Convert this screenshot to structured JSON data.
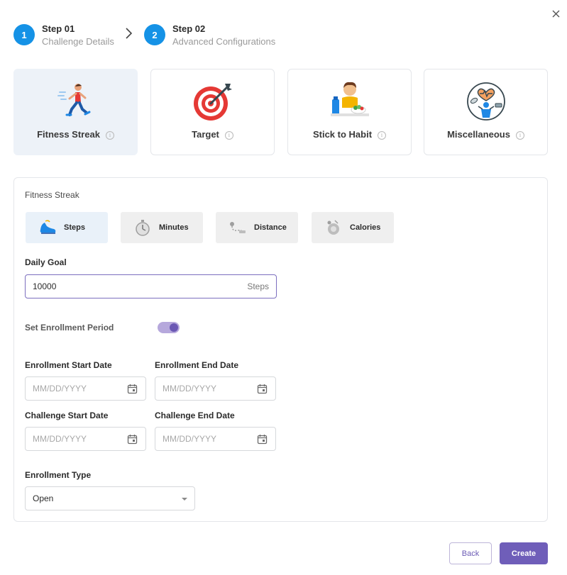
{
  "stepper": {
    "steps": [
      {
        "number": "1",
        "title": "Step 01",
        "subtitle": "Challenge Details"
      },
      {
        "number": "2",
        "title": "Step 02",
        "subtitle": "Advanced Configurations"
      }
    ]
  },
  "categories": [
    {
      "label": "Fitness Streak",
      "icon": "runner-icon",
      "active": true
    },
    {
      "label": "Target",
      "icon": "target-icon",
      "active": false
    },
    {
      "label": "Stick to Habit",
      "icon": "habit-icon",
      "active": false
    },
    {
      "label": "Miscellaneous",
      "icon": "wellness-icon",
      "active": false
    }
  ],
  "fitness": {
    "section_label": "Fitness Streak",
    "metrics": [
      {
        "label": "Steps",
        "icon": "shoe-icon",
        "active": true
      },
      {
        "label": "Minutes",
        "icon": "stopwatch-icon",
        "active": false
      },
      {
        "label": "Distance",
        "icon": "distance-icon",
        "active": false
      },
      {
        "label": "Calories",
        "icon": "calories-icon",
        "active": false
      }
    ]
  },
  "daily_goal": {
    "label": "Daily Goal",
    "value": "10000",
    "unit": "Steps"
  },
  "enrollment_period": {
    "label": "Set Enrollment Period",
    "enabled": true
  },
  "dates": {
    "enrollment_start": {
      "label": "Enrollment Start Date",
      "placeholder": "MM/DD/YYYY"
    },
    "enrollment_end": {
      "label": "Enrollment End Date",
      "placeholder": "MM/DD/YYYY"
    },
    "challenge_start": {
      "label": "Challenge Start Date",
      "placeholder": "MM/DD/YYYY"
    },
    "challenge_end": {
      "label": "Challenge End Date",
      "placeholder": "MM/DD/YYYY"
    }
  },
  "enrollment_type": {
    "label": "Enrollment Type",
    "value": "Open"
  },
  "actions": {
    "back_label": "Back",
    "create_label": "Create"
  },
  "colors": {
    "accent": "#6f5eb9",
    "step": "#1592e6",
    "active_card": "#edf2f8"
  }
}
